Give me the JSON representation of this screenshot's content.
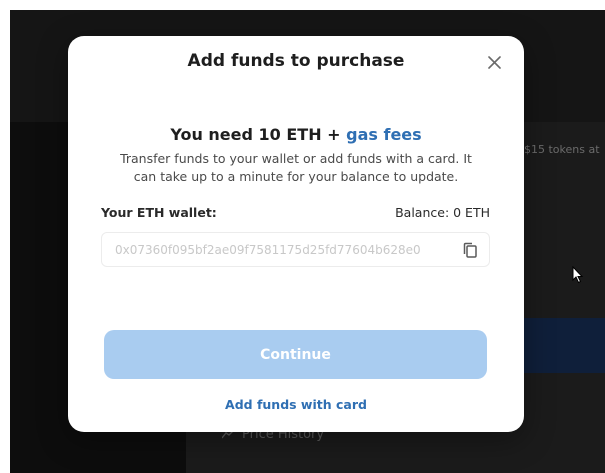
{
  "background": {
    "side_text": "$15 tokens at",
    "bottom_text": "Price History"
  },
  "modal": {
    "title": "Add funds to purchase",
    "need_prefix": "You need 10 ETH + ",
    "need_link": "gas fees",
    "subtext": "Transfer funds to your wallet or add funds with a card. It can take up to a minute for your balance to update.",
    "wallet_label": "Your ETH wallet:",
    "balance": "Balance: 0 ETH",
    "address": "0x07360f095bf2ae09f7581175d25fd77604b628e0",
    "continue_label": "Continue",
    "card_link": "Add funds with card"
  },
  "colors": {
    "accent": "#2f6fb3",
    "button_disabled": "#a9ccf0",
    "overlay": "#151515"
  },
  "icons": {
    "close": "close-icon",
    "copy": "copy-icon",
    "cursor": "mouse-cursor-icon",
    "chart": "chart-icon"
  }
}
